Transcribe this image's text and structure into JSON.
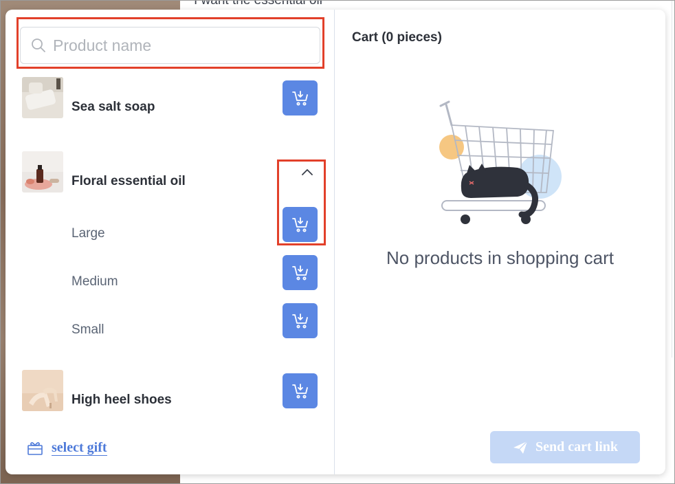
{
  "background": {
    "chat_text": "I want the essential oil"
  },
  "search": {
    "placeholder": "Product name"
  },
  "products": [
    {
      "name": "Sea salt soap"
    },
    {
      "name": "Floral essential oil",
      "expanded": true,
      "variants": [
        {
          "name": "Large"
        },
        {
          "name": "Medium"
        },
        {
          "name": "Small"
        }
      ]
    },
    {
      "name": "High heel shoes"
    }
  ],
  "gift": {
    "label": "select gift"
  },
  "cart": {
    "title": "Cart (0 pieces)",
    "empty_text": "No products in shopping cart",
    "send_label": "Send cart link"
  },
  "colors": {
    "accent": "#5b87e3",
    "highlight": "#e2402a",
    "send_disabled": "#c5d8f6"
  },
  "icons": [
    "search-icon",
    "add-to-cart-icon",
    "chevron-up-icon",
    "gift-icon",
    "paper-plane-icon"
  ]
}
